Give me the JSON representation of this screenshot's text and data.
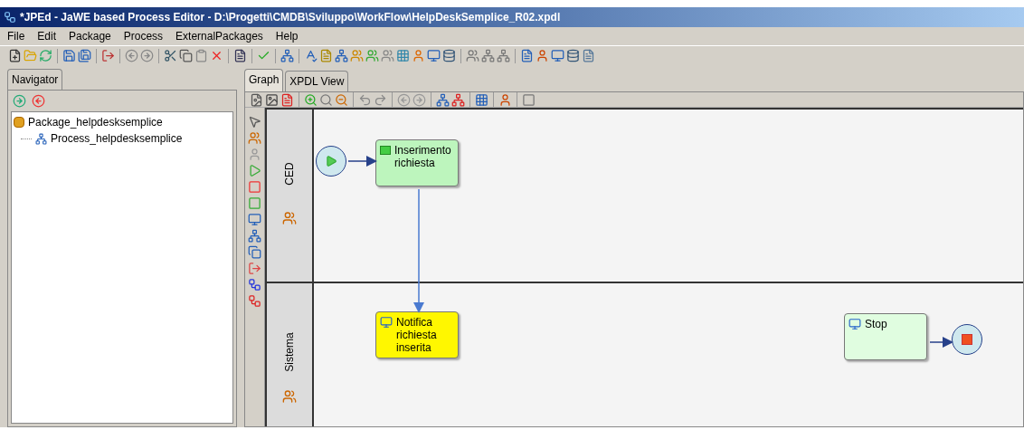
{
  "window": {
    "title": "*JPEd - JaWE based Process Editor - D:\\Progetti\\CMDB\\Sviluppo\\WorkFlow\\HelpDeskSemplice_R02.xpdl"
  },
  "menu": [
    "File",
    "Edit",
    "Package",
    "Process",
    "ExternalPackages",
    "Help"
  ],
  "navigator": {
    "tab": "Navigator",
    "tree": [
      {
        "label": "Package_helpdesksemplice",
        "children": [
          {
            "label": "Process_helpdesksemplice"
          }
        ]
      }
    ]
  },
  "editor_tabs": [
    {
      "label": "Graph",
      "selected": true
    },
    {
      "label": "XPDL View",
      "selected": false
    }
  ],
  "lanes": [
    {
      "name": "CED",
      "nodes": [
        {
          "kind": "start"
        },
        {
          "kind": "generic",
          "label": "Inserimento richiesta",
          "selected": false
        }
      ]
    },
    {
      "name": "Sistema",
      "nodes": [
        {
          "kind": "tool",
          "label": "Notifica richiesta inserita",
          "selected": true
        },
        {
          "kind": "tool",
          "label": "Stop",
          "selected": false
        },
        {
          "kind": "end"
        }
      ]
    }
  ]
}
